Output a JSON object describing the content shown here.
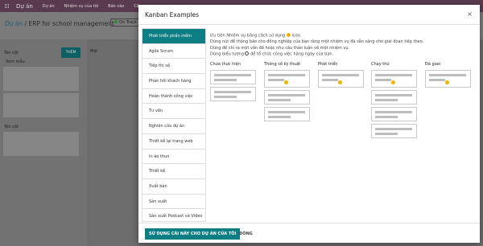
{
  "topbar": {
    "app_name": "Dự án",
    "menu": [
      "Dự án",
      "Nhiệm vụ của tôi",
      "Báo cáo",
      "Cấu"
    ]
  },
  "control": {
    "breadcrumb_root": "Dự án",
    "breadcrumb_rest": " / ERP for school management",
    "status": "On Track"
  },
  "background": {
    "column_name": "Tên cột",
    "add_button": "THÊM",
    "sample": "Xem mẫu",
    "column_name_2": "Tên cột",
    "mid_column": "Mới"
  },
  "modal": {
    "title": "Kanban Examples",
    "close": "×",
    "sidebar": [
      "Phát triển phần mềm",
      "Agile Scrum",
      "Tiếp thị số",
      "Phản hồi khách hàng",
      "Hoàn thành công việc",
      "Tư vấn",
      "Nghiên cứu dự án",
      "Thiết kế lại trang web",
      "In áo thun",
      "Thiết kế",
      "Xuất bản",
      "Sản xuất",
      "Sản xuất Podcast và Video"
    ],
    "active_index": 0,
    "description": {
      "line1a": "Ưu tiên Nhiệm vụ bằng cách sử dụng",
      "line1b": "icon.",
      "line2": "Dùng nút để thông báo cho đồng nghiệp của bạn rằng một nhiệm vụ đã sẵn sàng cho giai đoạn tiếp theo.",
      "line3": "Dùng đề chỉ ra một vấn đề hoặc nhu cầu thảo luận về một nhiệm vụ.",
      "line4a": "Dùng biểu tượng",
      "line4b": "để tổ chức công việc hàng ngày của bạn."
    },
    "columns": [
      {
        "title": "Chưa thực hiện"
      },
      {
        "title": "Thông số kỹ thuật"
      },
      {
        "title": "Phát triển"
      },
      {
        "title": "Chạy thử"
      },
      {
        "title": "Đã giao"
      }
    ],
    "footer": {
      "primary": "SỬ DỤNG CÁI NÀY CHO DỰ ÁN CỦA TÔI",
      "secondary": "ĐÓNG"
    }
  }
}
